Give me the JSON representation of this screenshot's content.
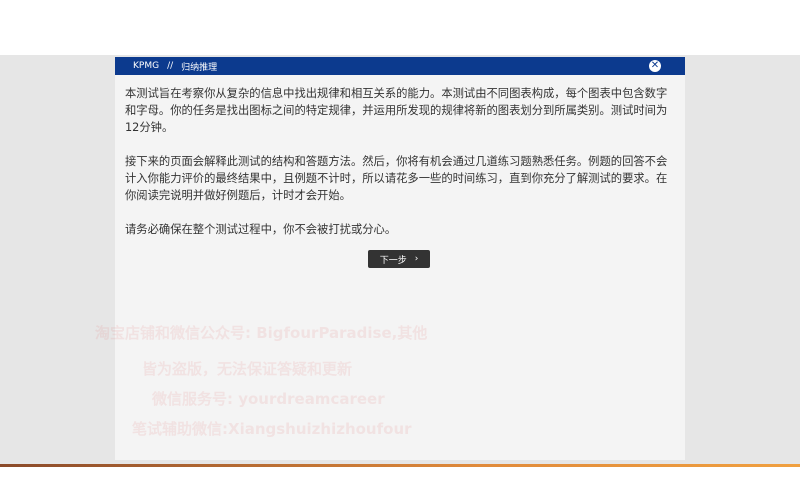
{
  "header": {
    "brand": "KPMG",
    "separator": "//",
    "title": "归纳推理"
  },
  "body": {
    "paragraphs": [
      "本测试旨在考察你从复杂的信息中找出规律和相互关系的能力。本测试由不同图表构成，每个图表中包含数字和字母。你的任务是找出图标之间的特定规律，并运用所发现的规律将新的图表划分到所属类别。测试时间为12分钟。",
      "接下来的页面会解释此测试的结构和答题方法。然后，你将有机会通过几道练习题熟悉任务。例题的回答不会计入你能力评价的最终结果中，且例题不计时，所以请花多一些的时间练习，直到你充分了解测试的要求。在你阅读完说明并做好例题后，计时才会开始。",
      "请务必确保在整个测试过程中，你不会被打扰或分心。"
    ]
  },
  "next_button": {
    "label": "下一步",
    "icon": "chevron-right-icon"
  },
  "watermark": {
    "lines": [
      "淘宝店铺和微信公众号: BigfourParadise,其他",
      "皆为盗版，无法保证答疑和更新",
      "微信服务号: yourdreamcareer",
      "笔试辅助微信:Xiangshuizhizhoufour"
    ]
  },
  "colors": {
    "header": "#0c3a8e",
    "button": "#333333",
    "backdrop": "#e6e6e6"
  }
}
